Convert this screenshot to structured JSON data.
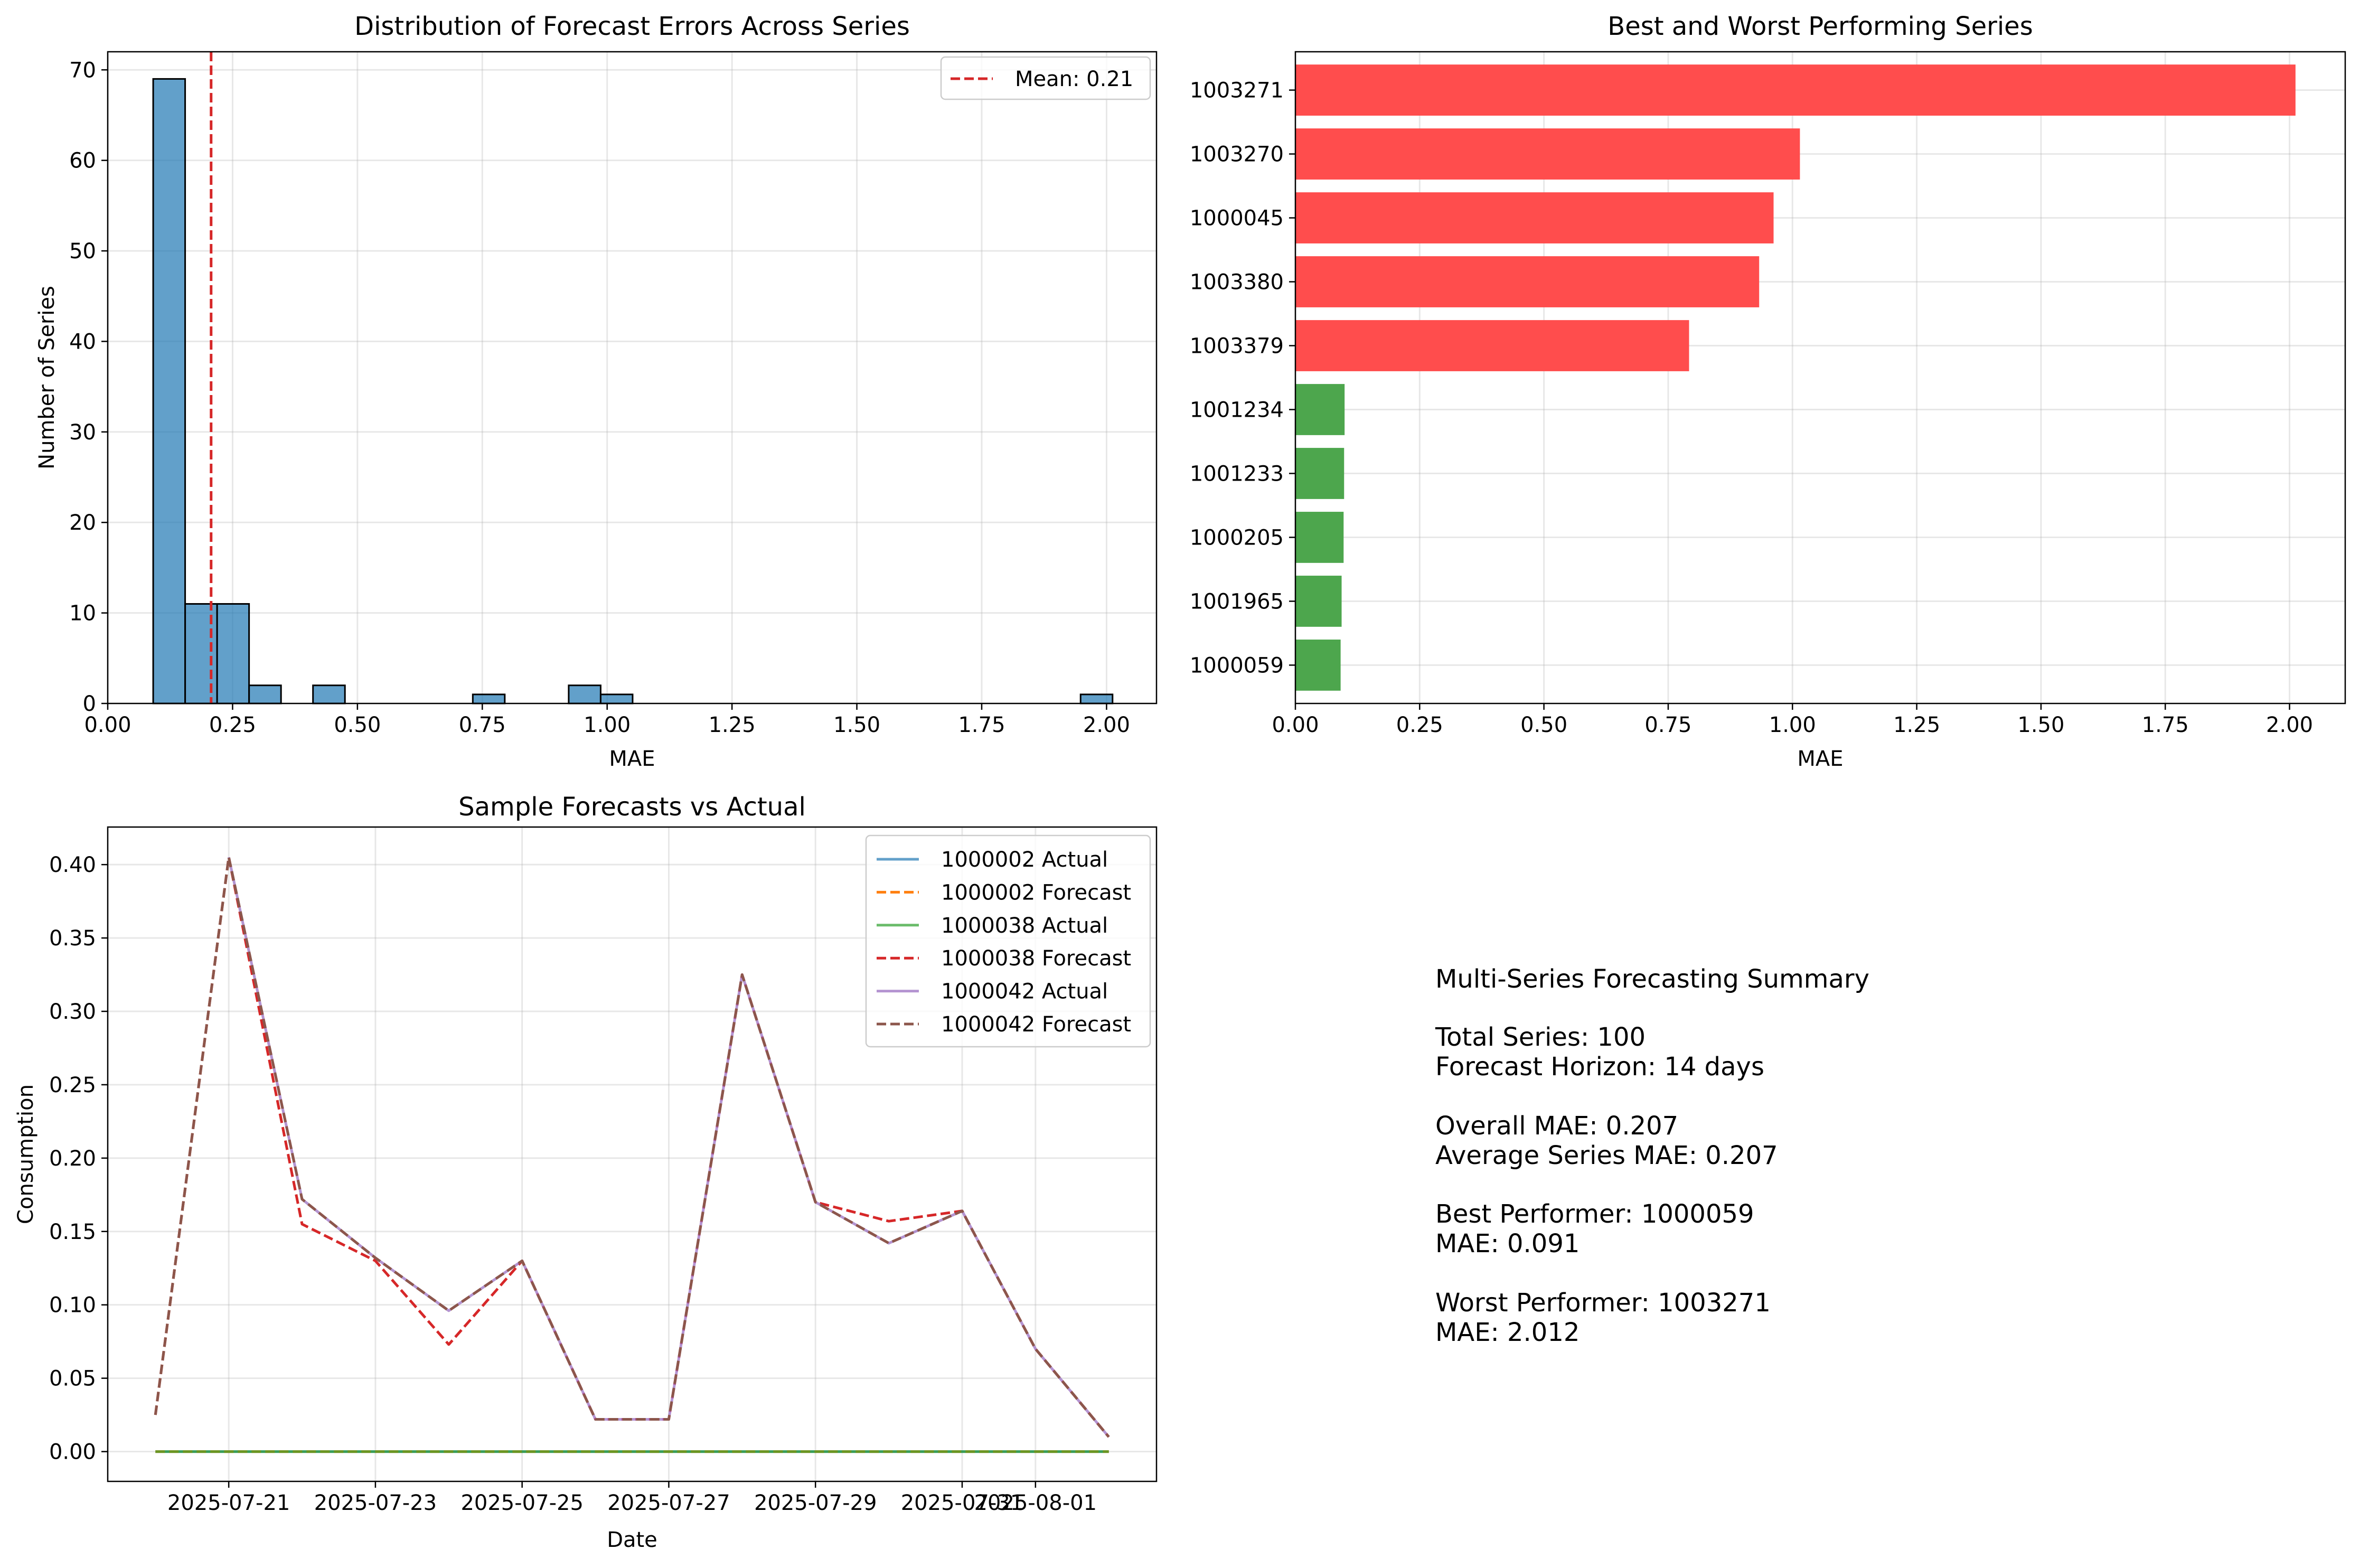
{
  "chart_data": [
    {
      "type": "bar",
      "subtype": "histogram",
      "title": "Distribution of Forecast Errors Across Series",
      "xlabel": "MAE",
      "ylabel": "Number of Series",
      "xlim": [
        0.0,
        2.1
      ],
      "ylim": [
        0,
        72
      ],
      "xticks": [
        "0.00",
        "0.25",
        "0.50",
        "0.75",
        "1.00",
        "1.25",
        "1.50",
        "1.75",
        "2.00"
      ],
      "yticks": [
        "0",
        "10",
        "20",
        "30",
        "40",
        "50",
        "60",
        "70"
      ],
      "color": "#1f77b4",
      "bins": [
        {
          "start": 0.091,
          "end": 0.155,
          "count": 69
        },
        {
          "start": 0.155,
          "end": 0.219,
          "count": 11
        },
        {
          "start": 0.219,
          "end": 0.283,
          "count": 11
        },
        {
          "start": 0.283,
          "end": 0.347,
          "count": 2
        },
        {
          "start": 0.411,
          "end": 0.475,
          "count": 2
        },
        {
          "start": 0.731,
          "end": 0.795,
          "count": 1
        },
        {
          "start": 0.923,
          "end": 0.987,
          "count": 2
        },
        {
          "start": 0.987,
          "end": 1.051,
          "count": 1
        },
        {
          "start": 1.948,
          "end": 2.012,
          "count": 1
        }
      ],
      "mean_line": {
        "value": 0.207,
        "label": "Mean: 0.21",
        "color": "#d62728"
      },
      "legend_position": "upper right",
      "grid": true
    },
    {
      "type": "bar",
      "orientation": "horizontal",
      "title": "Best and Worst Performing Series",
      "xlabel": "MAE",
      "xlim": [
        0.0,
        2.112
      ],
      "xticks": [
        "0.00",
        "0.25",
        "0.50",
        "0.75",
        "1.00",
        "1.25",
        "1.50",
        "1.75",
        "2.00"
      ],
      "categories": [
        "1003271",
        "1003270",
        "1000045",
        "1003380",
        "1003379",
        "1001234",
        "1001233",
        "1000205",
        "1001965",
        "1000059"
      ],
      "values": [
        2.012,
        1.015,
        0.962,
        0.933,
        0.792,
        0.099,
        0.098,
        0.097,
        0.093,
        0.091
      ],
      "colors": [
        "#ff4d4d",
        "#ff4d4d",
        "#ff4d4d",
        "#ff4d4d",
        "#ff4d4d",
        "#4da64d",
        "#4da64d",
        "#4da64d",
        "#4da64d",
        "#4da64d"
      ],
      "grid": true
    },
    {
      "type": "line",
      "title": "Sample Forecasts vs Actual",
      "xlabel": "Date",
      "ylabel": "Consumption",
      "ylim": [
        -0.0203,
        0.4256
      ],
      "yticks": [
        "0.00",
        "0.05",
        "0.10",
        "0.15",
        "0.20",
        "0.25",
        "0.30",
        "0.35",
        "0.40"
      ],
      "xticks": [
        "2025-07-21",
        "2025-07-23",
        "2025-07-25",
        "2025-07-27",
        "2025-07-29",
        "2025-07-31",
        "2025-08-01"
      ],
      "x": [
        "2025-07-20",
        "2025-07-21",
        "2025-07-22",
        "2025-07-23",
        "2025-07-24",
        "2025-07-25",
        "2025-07-26",
        "2025-07-27",
        "2025-07-28",
        "2025-07-29",
        "2025-07-30",
        "2025-07-31",
        "2025-08-01",
        "2025-08-02"
      ],
      "series": [
        {
          "name": "1000002 Actual",
          "color": "#1f77b4",
          "dash": false,
          "alpha": 0.7,
          "values": [
            0,
            0,
            0,
            0,
            0,
            0,
            0,
            0,
            0,
            0,
            0,
            0,
            0,
            0
          ]
        },
        {
          "name": "1000002 Forecast",
          "color": "#ff7f0e",
          "dash": true,
          "alpha": 1,
          "values": [
            0,
            0,
            0,
            0,
            0,
            0,
            0,
            0,
            0,
            0,
            0,
            0,
            0,
            0
          ]
        },
        {
          "name": "1000038 Actual",
          "color": "#2ca02c",
          "dash": false,
          "alpha": 0.7,
          "values": [
            0,
            0,
            0,
            0,
            0,
            0,
            0,
            0,
            0,
            0,
            0,
            0,
            0,
            0
          ]
        },
        {
          "name": "1000038 Forecast",
          "color": "#d62728",
          "dash": true,
          "alpha": 1,
          "values": [
            0.025,
            0.405,
            0.155,
            0.13,
            0.073,
            0.13,
            0.022,
            0.022,
            0.325,
            0.17,
            0.157,
            0.164,
            0.07,
            0.01
          ]
        },
        {
          "name": "1000042 Actual",
          "color": "#9467bd",
          "dash": false,
          "alpha": 0.7,
          "values": [
            null,
            0.405,
            0.172,
            0.132,
            0.096,
            0.13,
            0.022,
            0.022,
            0.325,
            0.17,
            0.142,
            0.164,
            0.07,
            0.01
          ]
        },
        {
          "name": "1000042 Forecast",
          "color": "#8c564b",
          "dash": true,
          "alpha": 1,
          "values": [
            0.025,
            0.405,
            0.172,
            0.132,
            0.096,
            0.13,
            0.022,
            0.022,
            0.325,
            0.17,
            0.142,
            0.164,
            0.07,
            0.01
          ]
        }
      ],
      "legend_position": "upper right",
      "grid": true
    }
  ],
  "summary": {
    "title": "Multi-Series Forecasting Summary",
    "total_series": "Total Series: 100",
    "forecast_horizon": "Forecast Horizon: 14 days",
    "overall_mae": "Overall MAE: 0.207",
    "average_series_mae": "Average Series MAE: 0.207",
    "best_performer": "Best Performer: 1000059",
    "best_mae": "MAE: 0.091",
    "worst_performer": "Worst Performer: 1003271",
    "worst_mae": "MAE: 2.012"
  }
}
